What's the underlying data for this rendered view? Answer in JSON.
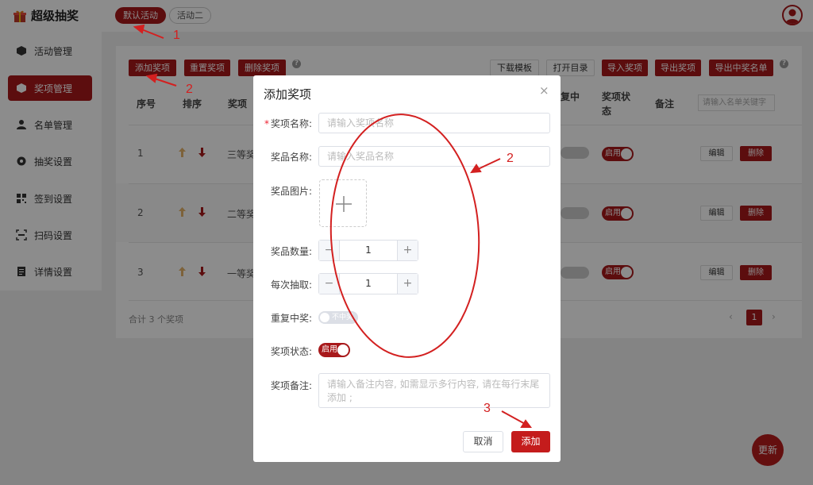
{
  "app": {
    "title": "超级抽奖",
    "activity_tabs": [
      "默认活动",
      "活动二"
    ],
    "brand_color": "#a8191b"
  },
  "sidebar": {
    "items": [
      {
        "label": "活动管理",
        "icon": "box-icon"
      },
      {
        "label": "奖项管理",
        "icon": "box-icon"
      },
      {
        "label": "名单管理",
        "icon": "user-icon"
      },
      {
        "label": "抽奖设置",
        "icon": "gear-icon"
      },
      {
        "label": "签到设置",
        "icon": "qrcode-icon"
      },
      {
        "label": "扫码设置",
        "icon": "scan-icon"
      },
      {
        "label": "详情设置",
        "icon": "document-icon"
      }
    ],
    "active_index": 1
  },
  "toolbar": {
    "add": "添加奖项",
    "reset": "重置奖项",
    "delete": "删除奖项",
    "download_template": "下载模板",
    "open_dir": "打开目录",
    "import": "导入奖项",
    "export": "导出奖项",
    "export_winners": "导出中奖名单"
  },
  "table": {
    "headers": {
      "index": "序号",
      "sort": "排序",
      "prize": "奖项",
      "repeat": "复中",
      "status_1": "奖项状",
      "status_2": "态",
      "note": "备注"
    },
    "search_placeholder": "请输入名单关键字",
    "rows": [
      {
        "index": "1",
        "prize": "三等奖",
        "status": "启用",
        "edit": "编辑",
        "delete": "删除"
      },
      {
        "index": "2",
        "prize": "二等奖",
        "status": "启用",
        "edit": "编辑",
        "delete": "删除"
      },
      {
        "index": "3",
        "prize": "一等奖",
        "status": "启用",
        "edit": "编辑",
        "delete": "删除"
      }
    ],
    "total": "合计 3 个奖项",
    "current_page": "1"
  },
  "modal": {
    "title": "添加奖项",
    "close": "×",
    "fields": {
      "prize_name_label": "奖项名称:",
      "prize_name_placeholder": "请输入奖项名称",
      "item_name_label": "奖品名称:",
      "item_name_placeholder": "请输入奖品名称",
      "image_label": "奖品图片:",
      "quantity_label": "奖品数量:",
      "quantity_value": "1",
      "per_draw_label": "每次抽取:",
      "per_draw_value": "1",
      "repeat_label": "重复中奖:",
      "repeat_switch_text": "不中奖",
      "status_label": "奖项状态:",
      "status_switch_text": "启用",
      "note_label": "奖项备注:",
      "note_placeholder": "请输入备注内容, 如需显示多行内容, 请在每行末尾添加 ;"
    },
    "cancel": "取消",
    "confirm": "添加"
  },
  "annotations": [
    "1",
    "2",
    "2",
    "3"
  ],
  "floating_button": "更新"
}
